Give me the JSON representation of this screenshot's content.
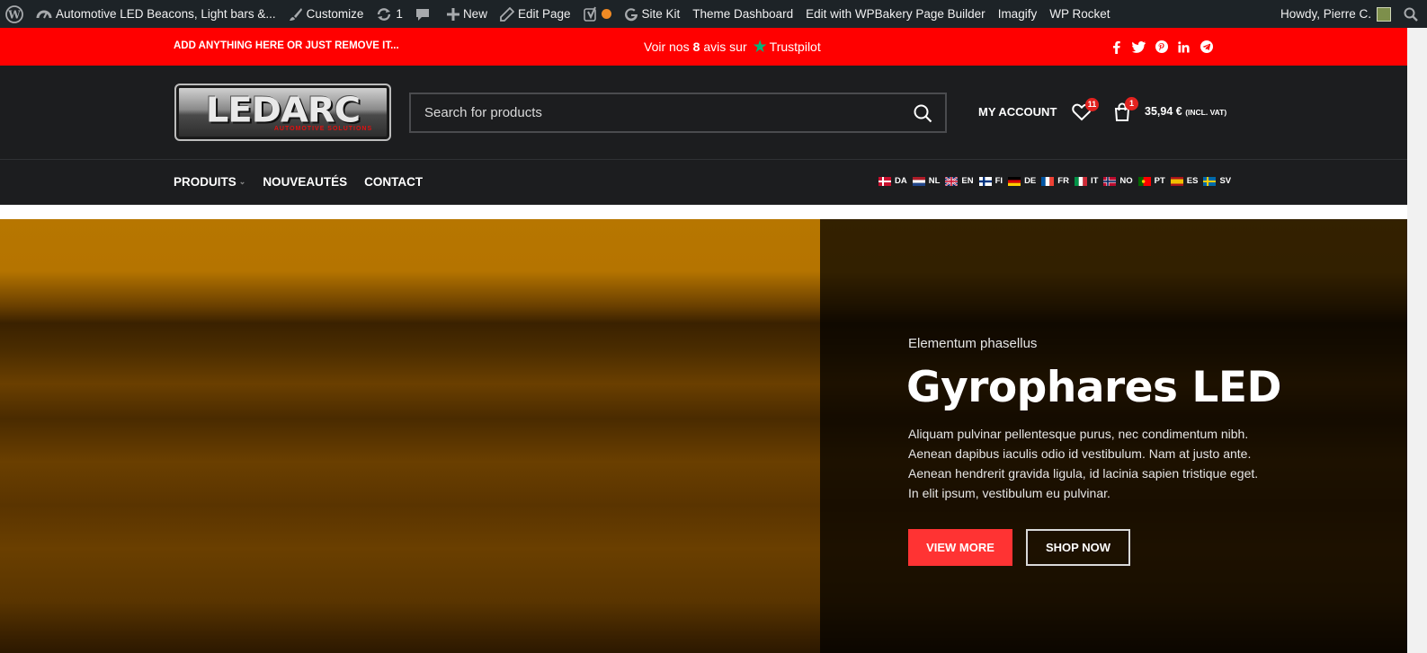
{
  "admin_bar": {
    "site_name": "Automotive LED Beacons, Light bars &...",
    "customize": "Customize",
    "updates_count": "1",
    "new": "New",
    "edit_page": "Edit Page",
    "site_kit": "Site Kit",
    "theme_dashboard": "Theme Dashboard",
    "wpbakery": "Edit with WPBakery Page Builder",
    "imagify": "Imagify",
    "wp_rocket": "WP Rocket",
    "howdy": "Howdy, Pierre C."
  },
  "topbar": {
    "promo": "ADD ANYTHING HERE OR JUST REMOVE IT...",
    "trust_prefix": "Voir nos",
    "trust_count": "8",
    "trust_suffix": "avis sur",
    "trust_brand": "Trustpilot",
    "socials": [
      "facebook-icon",
      "twitter-icon",
      "pinterest-icon",
      "linkedin-icon",
      "telegram-icon"
    ]
  },
  "header": {
    "logo_text": "LEDARC",
    "logo_sub": "AUTOMOTIVE SOLUTIONS",
    "search_placeholder": "Search for products",
    "account": "MY ACCOUNT",
    "wishlist_count": "11",
    "cart_count": "1",
    "cart_total": "35,94 €",
    "cart_vat": "(INCL. VAT)"
  },
  "nav": {
    "items": [
      "PRODUITS",
      "NOUVEAUTÉS",
      "CONTACT"
    ]
  },
  "languages": [
    "DA",
    "NL",
    "EN",
    "FI",
    "DE",
    "FR",
    "IT",
    "NO",
    "PT",
    "ES",
    "SV"
  ],
  "hero": {
    "pretitle": "Elementum phasellus",
    "title": "Gyrophares LED",
    "description": "Aliquam pulvinar pellentesque purus, nec condimentum nibh. Aenean dapibus iaculis odio id vestibulum. Nam at justo ante. Aenean hendrerit gravida ligula, id lacinia sapien tristique eget. In elit ipsum, vestibulum eu pulvinar.",
    "btn_more": "VIEW MORE",
    "btn_shop": "SHOP NOW"
  },
  "colors": {
    "admin_bg": "#1d2327",
    "topbar_red": "#ff0000",
    "header_bg": "#1c1d1f",
    "accent_red": "#ff3333",
    "trustpilot_green": "#00b67a"
  }
}
